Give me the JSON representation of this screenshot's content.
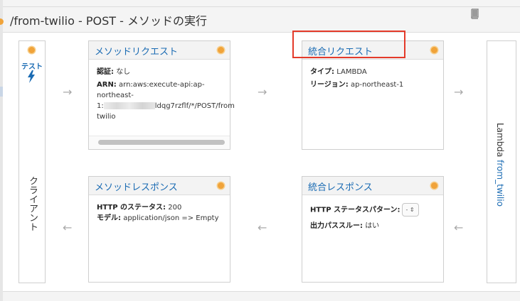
{
  "page": {
    "title": "/from-twilio - POST - メソッドの実行"
  },
  "client": {
    "test_label": "テスト",
    "label": "クライアント"
  },
  "lambda": {
    "prefix": "Lambda",
    "function_name": "from_twilio"
  },
  "method_request": {
    "title": "メソッドリクエスト",
    "auth_label": "認証:",
    "auth_value": "なし",
    "arn_label": "ARN:",
    "arn_line1": "arn:aws:execute-api:ap-",
    "arn_line2": "northeast-",
    "arn_line3_prefix": "1:",
    "arn_line3_suffix": "ldqg7rzflf/*/POST/from",
    "arn_line4": "twilio"
  },
  "integration_request": {
    "title": "統合リクエスト",
    "type_label": "タイプ:",
    "type_value": "LAMBDA",
    "region_label": "リージョン:",
    "region_value": "ap-northeast-1"
  },
  "method_response": {
    "title": "メソッドレスポンス",
    "status_label": "HTTP のステータス:",
    "status_value": "200",
    "model_label": "モデル:",
    "model_value": "application/json => Empty"
  },
  "integration_response": {
    "title": "統合レスポンス",
    "pattern_label": "HTTP ステータスパターン:",
    "pattern_value": "-",
    "passthrough_label": "出力パススルー:",
    "passthrough_value": "はい"
  },
  "arrows": {
    "right": "→",
    "left": "←"
  },
  "colors": {
    "link": "#1a6bb3",
    "status_dot": "#f0a33a",
    "highlight": "#e43a2a"
  }
}
